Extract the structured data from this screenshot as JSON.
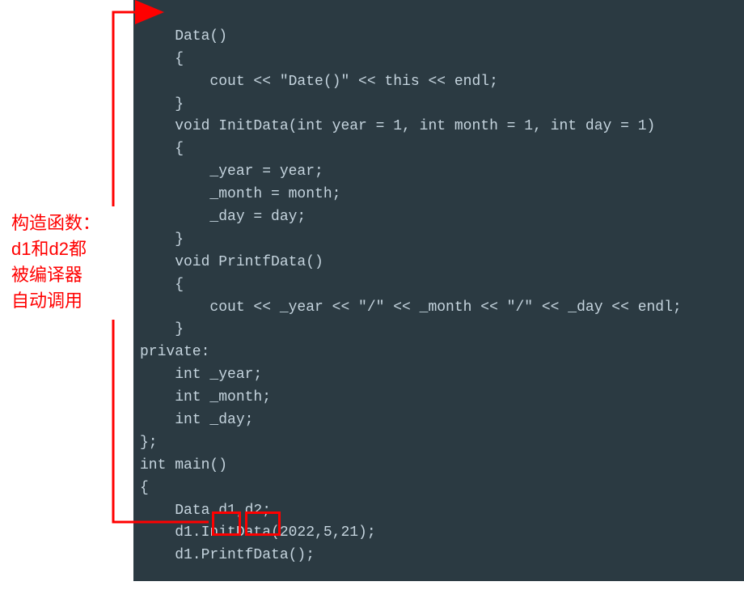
{
  "annotation": {
    "line1": "构造函数：",
    "line2": "d1和d2都",
    "line3": "被编译器",
    "line4": "自动调用"
  },
  "code": {
    "l1": "    Data()",
    "l2": "    {",
    "l3": "        cout << \"Date()\" << this << endl;",
    "l4": "    }",
    "l5": "    void InitData(int year = 1, int month = 1, int day = 1)",
    "l6": "    {",
    "l7": "        _year = year;",
    "l8": "        _month = month;",
    "l9": "        _day = day;",
    "l10": "    }",
    "l11": "    void PrintfData()",
    "l12": "    {",
    "l13": "        cout << _year << \"/\" << _month << \"/\" << _day << endl;",
    "l14": "    }",
    "l15": "private:",
    "l16": "    int _year;",
    "l17": "    int _month;",
    "l18": "    int _day;",
    "l19": "};",
    "l20": "int main()",
    "l21": "{",
    "l22": "    Data d1,d2;",
    "l23": "    d1.InitData(2022,5,21);",
    "l24": "    d1.PrintfData();"
  }
}
